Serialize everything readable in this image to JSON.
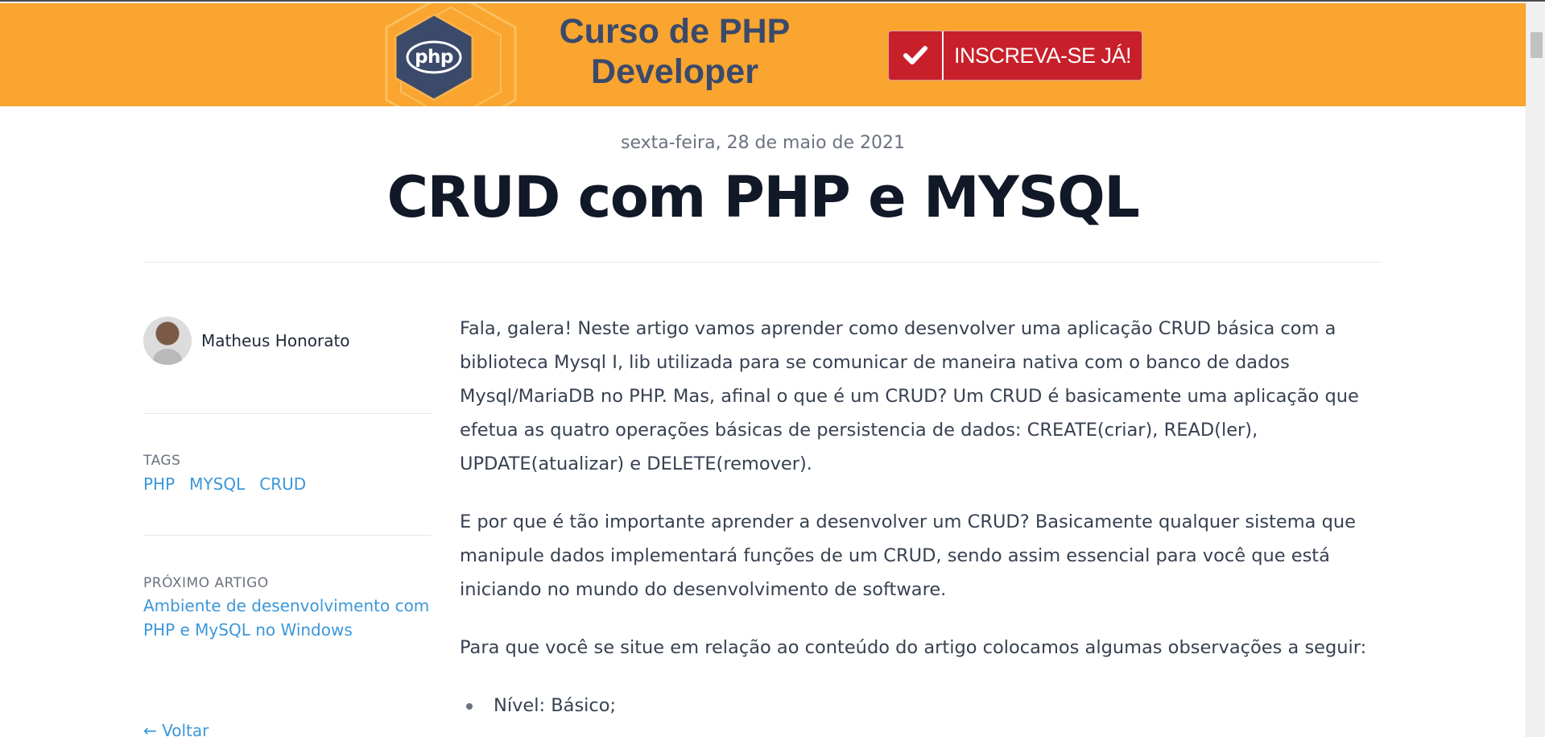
{
  "banner": {
    "logo_text": "php",
    "course_line1": "Curso de PHP",
    "course_line2": "Developer",
    "cta_label": "INSCREVA-SE JÁ!"
  },
  "post": {
    "date": "sexta-feira, 28 de maio de 2021",
    "title": "CRUD com PHP e MYSQL"
  },
  "sidebar": {
    "author_name": "Matheus Honorato",
    "tags_label": "TAGS",
    "tags": [
      "PHP",
      "MYSQL",
      "CRUD"
    ],
    "next_label": "PRÓXIMO ARTIGO",
    "next_title": "Ambiente de desenvolvimento com PHP e MySQL no Windows",
    "back_label": "← Voltar"
  },
  "content": {
    "paragraphs": [
      "Fala, galera! Neste artigo vamos aprender como desenvolver uma aplicação CRUD básica com a biblioteca Mysql I, lib utilizada para se comunicar de maneira nativa com o banco de dados Mysql/MariaDB no PHP. Mas, afinal o que é um CRUD? Um CRUD é basicamente uma aplicação que efetua as quatro operações básicas de persistencia de dados: CREATE(criar), READ(ler), UPDATE(atualizar) e DELETE(remover).",
      "E por que é tão importante aprender a desenvolver um CRUD? Basicamente qualquer sistema que manipule dados implementará funções de um CRUD, sendo assim essencial para você que está iniciando no mundo do desenvolvimento de software.",
      "Para que você se situe em relação ao conteúdo do artigo colocamos algumas observações a seguir:"
    ],
    "list": [
      "Nível: Básico;"
    ]
  },
  "colors": {
    "banner_bg": "#f9a52f",
    "cta_bg": "#c8202b",
    "link": "#3b97d9",
    "title": "#111827"
  }
}
